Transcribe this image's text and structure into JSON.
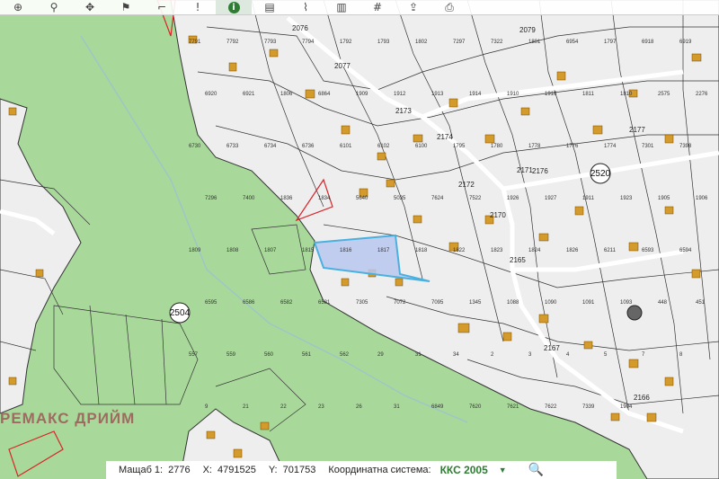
{
  "toolbar": {
    "tools": [
      "zoom-in-icon",
      "search-zoom-icon",
      "pan-icon",
      "location-pin-icon",
      "measure-area-icon",
      "measure-info-icon",
      "info-icon",
      "ruler-icon",
      "route-icon",
      "map-layers-icon",
      "grid-icon",
      "upload-icon",
      "print-icon"
    ],
    "active_tool": "info-icon"
  },
  "status": {
    "scale_label": "Мащаб 1:",
    "scale_value": "2776",
    "x_label": "X:",
    "x_value": "4791525",
    "y_label": "Y:",
    "y_value": "701753",
    "crs_label": "Координатна система:",
    "crs_value": "ККС 2005"
  },
  "watermark": "РЕМАКС ДРИЙМ",
  "map": {
    "colors": {
      "forest": "#a8d99a",
      "urban": "#eeeeee",
      "building": "#d49a2a",
      "selected_fill": "#b8c7ee",
      "selected_stroke": "#4ab0e0"
    },
    "region_labels": [
      "2504",
      "2520"
    ],
    "street_labels": [
      "2076",
      "2077",
      "2173",
      "2174",
      "2171",
      "2172",
      "2170",
      "2176",
      "2177",
      "2165",
      "2167",
      "2166",
      "2079"
    ],
    "parcel_labels": [
      "7791",
      "7792",
      "7793",
      "7794",
      "1792",
      "1793",
      "1802",
      "7297",
      "7322",
      "1801",
      "6954",
      "1797",
      "6918",
      "6919",
      "6920",
      "6921",
      "1806",
      "6864",
      "1909",
      "1912",
      "1913",
      "1914",
      "1910",
      "1916",
      "1811",
      "1810",
      "2575",
      "2276",
      "6730",
      "6733",
      "6734",
      "6736",
      "6101",
      "6102",
      "6100",
      "1795",
      "1780",
      "1778",
      "1776",
      "1774",
      "7301",
      "7398",
      "7296",
      "7400",
      "1836",
      "1834",
      "5640",
      "5035",
      "7624",
      "7522",
      "1926",
      "1927",
      "1911",
      "1923",
      "1905",
      "1906",
      "1809",
      "1808",
      "1807",
      "1815",
      "1816",
      "1817",
      "1818",
      "1822",
      "1823",
      "1824",
      "1826",
      "6211",
      "6593",
      "6594",
      "6595",
      "6586",
      "6582",
      "6581",
      "7305",
      "7072",
      "7095",
      "1345",
      "1088",
      "1090",
      "1091",
      "1093",
      "448",
      "451",
      "557",
      "559",
      "560",
      "561",
      "562",
      "29",
      "31",
      "34",
      "2",
      "3",
      "4",
      "5",
      "7",
      "8",
      "9",
      "21",
      "22",
      "23",
      "26",
      "31",
      "6849",
      "7620",
      "7621",
      "7622",
      "7339",
      "1904"
    ]
  }
}
